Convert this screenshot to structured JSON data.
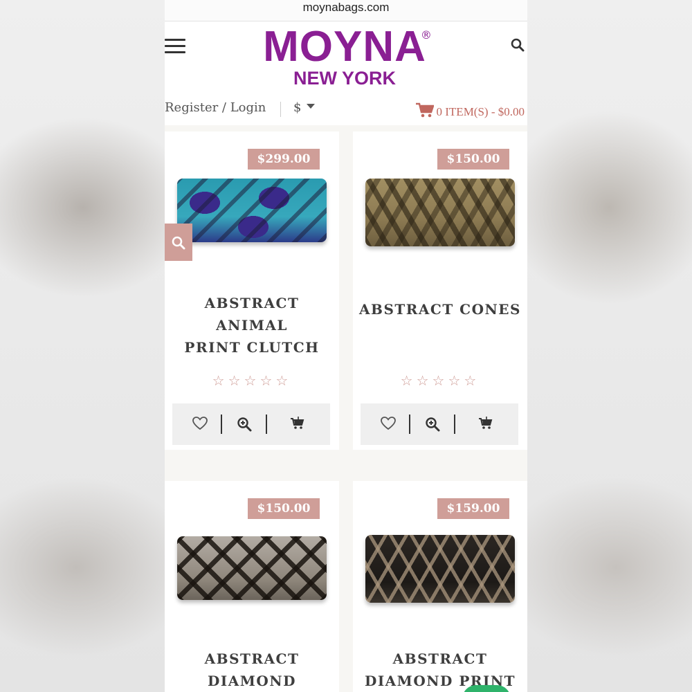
{
  "browser": {
    "url": "moynabags.com"
  },
  "header": {
    "logo_main": "MOYNA",
    "logo_reg": "®",
    "logo_sub": "NEW YORK",
    "register_login": "Register / Login",
    "currency": "$",
    "cart_label": "0 ITEM(S) - $0.00"
  },
  "colors": {
    "brand": "#8a1f93",
    "accent": "#cf9e98",
    "cart": "#c0675e"
  },
  "products": [
    {
      "name_line1": "ABSTRACT ANIMAL",
      "name_line2": "PRINT CLUTCH",
      "price": "$299.00",
      "rating": 0,
      "stars": "☆☆☆☆☆"
    },
    {
      "name_line1": "ABSTRACT CONES",
      "name_line2": "",
      "price": "$150.00",
      "rating": 0,
      "stars": "☆☆☆☆☆"
    },
    {
      "name_line1": "ABSTRACT",
      "name_line2": "DIAMOND CLUTCH",
      "price": "$150.00"
    },
    {
      "name_line1": "ABSTRACT",
      "name_line2": "DIAMOND PRINT",
      "price": "$159.00"
    }
  ]
}
